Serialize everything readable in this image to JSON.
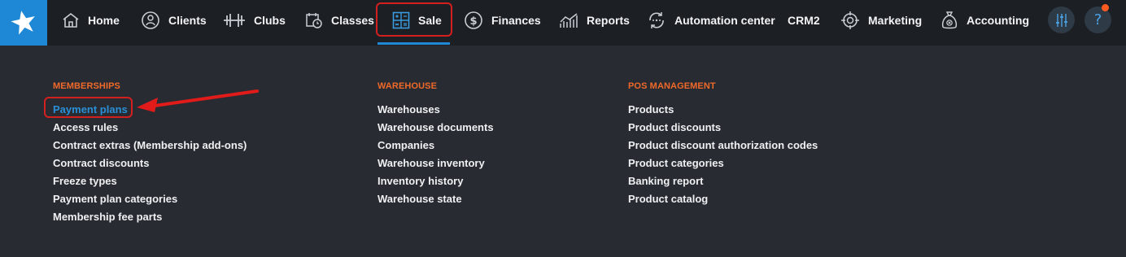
{
  "nav": {
    "items": [
      {
        "label": "Home",
        "icon": "home-icon"
      },
      {
        "label": "Clients",
        "icon": "clients-icon"
      },
      {
        "label": "Clubs",
        "icon": "dumbbell-icon"
      },
      {
        "label": "Classes",
        "icon": "calendar-clock-icon"
      },
      {
        "label": "Sale",
        "icon": "calculator-icon",
        "active": true
      },
      {
        "label": "Finances",
        "icon": "dollar-icon"
      },
      {
        "label": "Reports",
        "icon": "reports-chart-icon"
      },
      {
        "label": "Automation center",
        "icon": "automation-icon"
      },
      {
        "label": "CRM2",
        "icon": ""
      },
      {
        "label": "Marketing",
        "icon": "target-icon"
      },
      {
        "label": "Accounting",
        "icon": "money-bag-icon"
      }
    ],
    "help_label": "?"
  },
  "menu": {
    "memberships": {
      "heading": "MEMBERSHIPS",
      "items": [
        "Payment plans",
        "Access rules",
        "Contract extras (Membership add-ons)",
        "Contract discounts",
        "Freeze types",
        "Payment plan categories",
        "Membership fee parts"
      ]
    },
    "warehouse": {
      "heading": "WAREHOUSE",
      "items": [
        "Warehouses",
        "Warehouse documents",
        "Companies",
        "Warehouse inventory",
        "Inventory history",
        "Warehouse state"
      ]
    },
    "pos": {
      "heading": "POS MANAGEMENT",
      "items": [
        "Products",
        "Product discounts",
        "Product discount authorization codes",
        "Product categories",
        "Banking report",
        "Product catalog"
      ]
    }
  },
  "colors": {
    "accent": "#1e88d6",
    "heading": "#f0692a",
    "highlight": "#d41f1f",
    "notification": "#ff5a1f"
  }
}
